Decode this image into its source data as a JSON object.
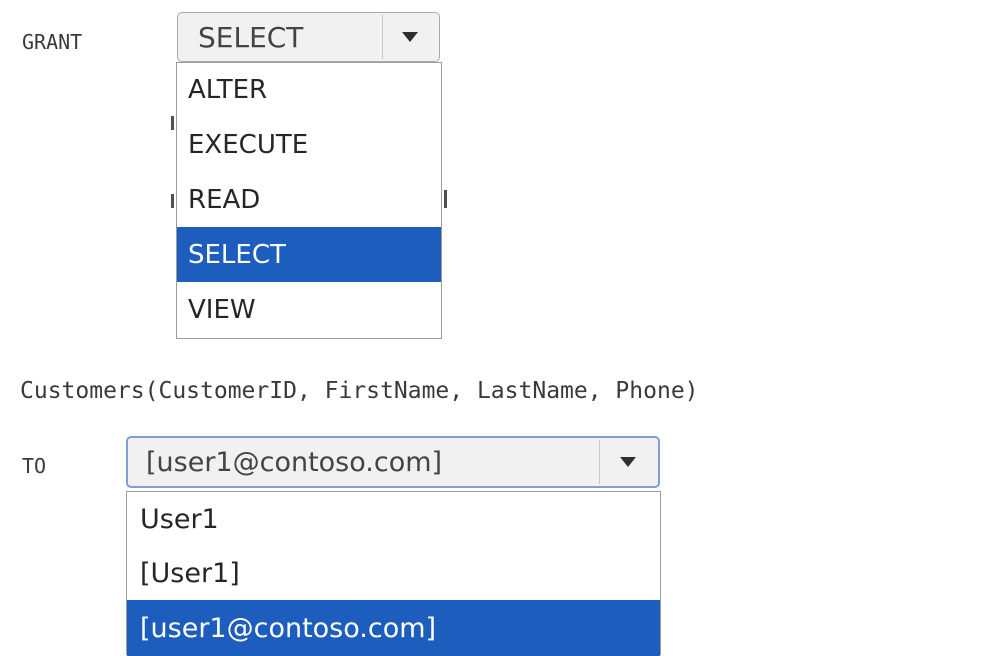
{
  "statement": {
    "grant_keyword": "GRANT",
    "object_line": "Customers(CustomerID, FirstName, LastName, Phone)",
    "to_keyword": "TO"
  },
  "permission_dropdown": {
    "selected_value": "SELECT",
    "options": [
      "ALTER",
      "EXECUTE",
      "READ",
      "SELECT",
      "VIEW"
    ],
    "highlighted_option": "SELECT"
  },
  "principal_dropdown": {
    "selected_value": "[user1@contoso.com]",
    "options": [
      "User1",
      "[User1]",
      "[user1@contoso.com]"
    ],
    "highlighted_option": "[user1@contoso.com]"
  },
  "colors": {
    "highlight": "#1c5dbd"
  },
  "icons": [
    "dropdown-arrow-icon"
  ]
}
